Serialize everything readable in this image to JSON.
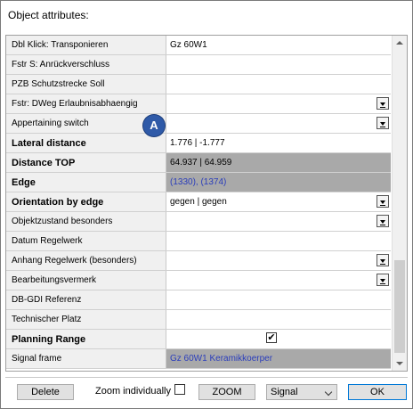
{
  "window": {
    "title": "Object attributes:"
  },
  "attributes": [
    {
      "name": "Dbl Klick: Transponieren",
      "value": "Gz 60W1",
      "bold": false,
      "shaded": false,
      "blue": false,
      "dropdown": false
    },
    {
      "name": "Fstr S: Anrückverschluss",
      "value": "",
      "bold": false,
      "shaded": false,
      "blue": false,
      "dropdown": false
    },
    {
      "name": "PZB Schutzstrecke Soll",
      "value": "",
      "bold": false,
      "shaded": false,
      "blue": false,
      "dropdown": false
    },
    {
      "name": "Fstr: DWeg Erlaubnisabhaengig",
      "value": "",
      "bold": false,
      "shaded": false,
      "blue": false,
      "dropdown": true
    },
    {
      "name": "Appertaining switch",
      "value": "",
      "bold": false,
      "shaded": false,
      "blue": false,
      "dropdown": true
    },
    {
      "name": "Lateral distance",
      "value": "1.776 | -1.777",
      "bold": true,
      "shaded": false,
      "blue": false,
      "dropdown": false
    },
    {
      "name": "Distance TOP",
      "value": "64.937 | 64.959",
      "bold": true,
      "shaded": true,
      "blue": false,
      "dropdown": false
    },
    {
      "name": "Edge",
      "value": "(1330), (1374)",
      "bold": true,
      "shaded": true,
      "blue": true,
      "dropdown": false
    },
    {
      "name": "Orientation by edge",
      "value": "gegen | gegen",
      "bold": true,
      "shaded": false,
      "blue": false,
      "dropdown": true
    },
    {
      "name": "Objektzustand besonders",
      "value": "",
      "bold": false,
      "shaded": false,
      "blue": false,
      "dropdown": true
    },
    {
      "name": "Datum Regelwerk",
      "value": "",
      "bold": false,
      "shaded": false,
      "blue": false,
      "dropdown": false
    },
    {
      "name": "Anhang Regelwerk (besonders)",
      "value": "",
      "bold": false,
      "shaded": false,
      "blue": false,
      "dropdown": true
    },
    {
      "name": "Bearbeitungsvermerk",
      "value": "",
      "bold": false,
      "shaded": false,
      "blue": false,
      "dropdown": true
    },
    {
      "name": "DB-GDI Referenz",
      "value": "",
      "bold": false,
      "shaded": false,
      "blue": false,
      "dropdown": false
    },
    {
      "name": "Technischer Platz",
      "value": "",
      "bold": false,
      "shaded": false,
      "blue": false,
      "dropdown": false
    },
    {
      "name": "Planning Range",
      "value": "",
      "bold": true,
      "shaded": false,
      "blue": false,
      "dropdown": false,
      "checkbox": true,
      "checked": true
    },
    {
      "name": "Signal frame",
      "value": "Gz 60W1 Keramikkoerper",
      "bold": false,
      "shaded": true,
      "blue": true,
      "dropdown": false
    }
  ],
  "annotation": {
    "label": "A"
  },
  "footer": {
    "delete_label": "Delete",
    "zoom_individually_label": "Zoom individually",
    "zoom_label": "ZOOM",
    "select_value": "Signal",
    "ok_label": "OK"
  },
  "colors": {
    "accent": "#2f5aa8",
    "link_blue": "#2a3dbb",
    "shaded_cell": "#a9a9a9"
  }
}
